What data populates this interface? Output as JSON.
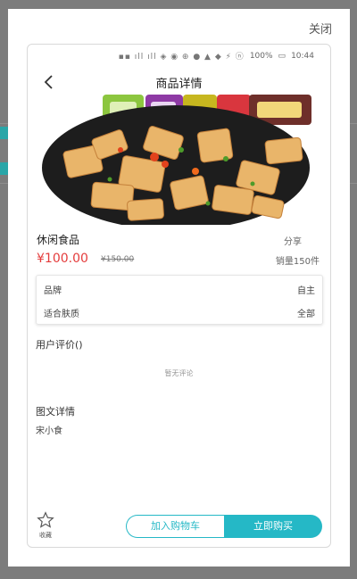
{
  "modal": {
    "close_label": "关闭"
  },
  "status_bar": {
    "battery": "100%",
    "time": "10:44"
  },
  "navbar": {
    "title": "商品详情"
  },
  "product": {
    "name": "休闲食品",
    "share_label": "分享",
    "price": "¥100.00",
    "original_price": "¥150.00",
    "sales": "销量150件"
  },
  "specs": [
    {
      "key": "品牌",
      "value": "自主"
    },
    {
      "key": "适合肤质",
      "value": "全部"
    }
  ],
  "reviews": {
    "title": "用户评价()",
    "empty_text": "暂无评论"
  },
  "details": {
    "title": "图文详情",
    "text": "宋小食"
  },
  "bottom_bar": {
    "favorite_label": "收藏",
    "add_to_cart_label": "加入购物车",
    "buy_now_label": "立即购买"
  },
  "colors": {
    "accent": "#25b8c6",
    "price": "#e43c3c"
  }
}
